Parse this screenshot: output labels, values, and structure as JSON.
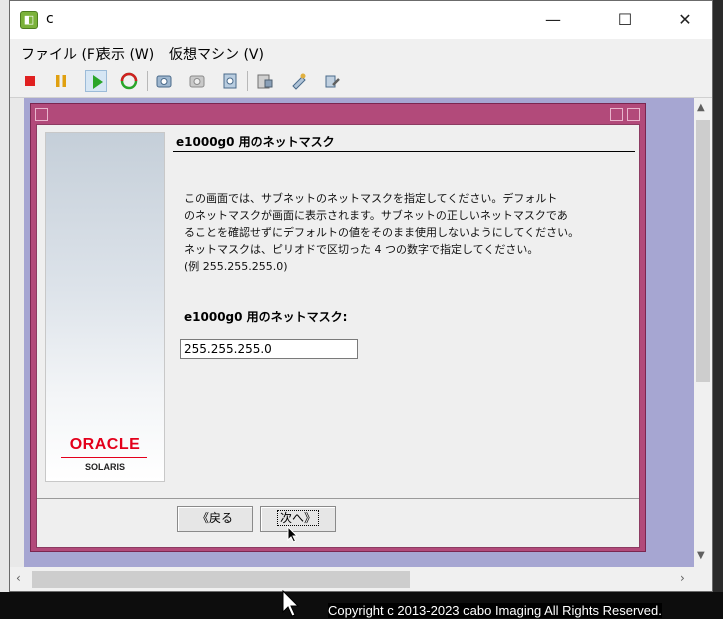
{
  "window": {
    "title": "c",
    "controls": {
      "minimize": "—",
      "maximize": "☐",
      "close": "✕"
    }
  },
  "menu": {
    "file": "ファイル (F)",
    "view": "表示 (W)",
    "vm": "仮想マシン (V)"
  },
  "toolbar": {
    "icons": [
      "stop-icon",
      "pause-icon",
      "play-icon",
      "reset-icon",
      "snapshot-take-icon",
      "snapshot-revert-icon",
      "snapshot-manager-icon",
      "settings-icon",
      "tools-icon",
      "configure-icon"
    ]
  },
  "dialog": {
    "heading": "e1000g0 用のネットマスク",
    "description": [
      "この画面では、サブネットのネットマスクを指定してください。デフォルト",
      "のネットマスクが画面に表示されます。サブネットの正しいネットマスクであ",
      "ることを確認せずにデフォルトの値をそのまま使用しないようにしてください。",
      "ネットマスクは、ピリオドで区切った 4 つの数字で指定してください。",
      "(例 255.255.255.0)"
    ],
    "field_label": "e1000g0 用のネットマスク:",
    "netmask_value": "255.255.255.0",
    "back_label": "戻る",
    "next_label": "次へ",
    "logo_brand": "ORACLE",
    "logo_product": "SOLARIS"
  },
  "desktop": {
    "copyright": "Copyright c 2013-2023 cabo Imaging All Rights Reserved."
  },
  "colors": {
    "dialog_frame": "#b24a7a",
    "viewport_bg": "#a6a6d2",
    "oracle_red": "#e3001b"
  }
}
